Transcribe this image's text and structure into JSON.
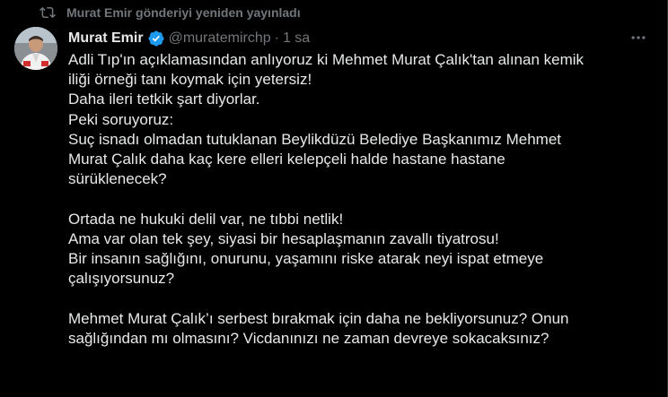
{
  "repost": {
    "icon": "repost-icon",
    "text": "Murat Emir gönderiyi yeniden yayınladı"
  },
  "author": {
    "name": "Murat Emir",
    "verified_icon": "verified-badge-icon",
    "handle": "@muratemirchp",
    "separator": "·",
    "time": "1 sa"
  },
  "more_icon": "more-options-icon",
  "body_lines": [
    "Adli Tıp'ın açıklamasından anlıyoruz ki Mehmet Murat Çalık'tan alınan kemik",
    "iliği örneği tanı koymak için yetersiz!",
    "Daha ileri tetkik şart diyorlar.",
    "Peki soruyoruz:",
    "Suç isnadı olmadan tutuklanan Beylikdüzü Belediye Başkanımız Mehmet",
    "Murat Çalık daha kaç kere elleri kelepçeli halde hastane hastane",
    "sürüklenecek?",
    "",
    "Ortada ne hukuki delil var, ne tıbbi netlik!",
    "Ama var olan tek şey, siyasi bir hesaplaşmanın zavallı tiyatrosu!",
    "Bir insanın sağlığını, onurunu, yaşamını riske atarak neyi ispat etmeye",
    "çalışıyorsunuz?",
    "",
    "Mehmet Murat Çalık’ı serbest bırakmak için daha ne bekliyorsunuz? Onun",
    "sağlığından mı olmasını? Vicdanınızı ne zaman devreye sokacaksınız?"
  ],
  "colors": {
    "background": "#000000",
    "text": "#e7e9ea",
    "muted": "#71767b",
    "verified": "#1d9bf0"
  }
}
